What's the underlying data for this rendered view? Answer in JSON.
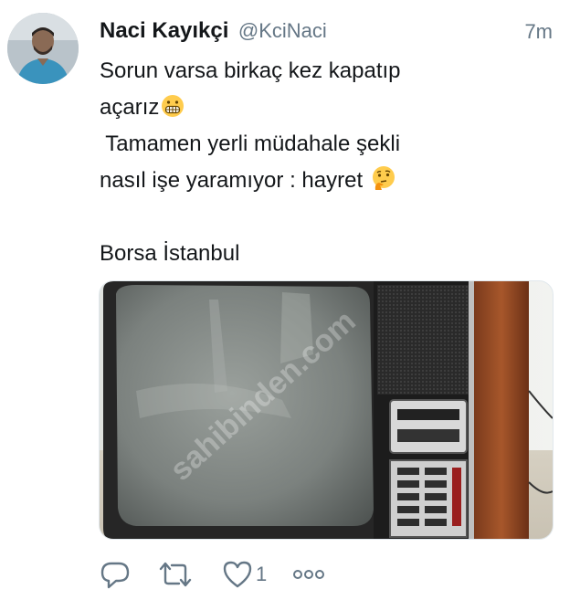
{
  "tweet": {
    "author_name": "Naci Kayıkçi",
    "handle": "@KciNaci",
    "time": "7m",
    "lines": [
      "Sorun varsa birkaç kez kapatıp",
      "açarız",
      " Tamamen yerli müdahale şekli",
      "nasıl işe yaramıyor : hayret ",
      "",
      "Borsa İstanbul"
    ],
    "media": {
      "watermark": "sahibinden.com"
    },
    "actions": {
      "like_count": "1"
    }
  },
  "colors": {
    "text": "#14171a",
    "secondary": "#657786",
    "border": "#e1e8ed"
  },
  "icons": [
    "reply-icon",
    "retweet-icon",
    "like-icon",
    "more-icon",
    "grimacing-emoji",
    "thinking-emoji"
  ]
}
